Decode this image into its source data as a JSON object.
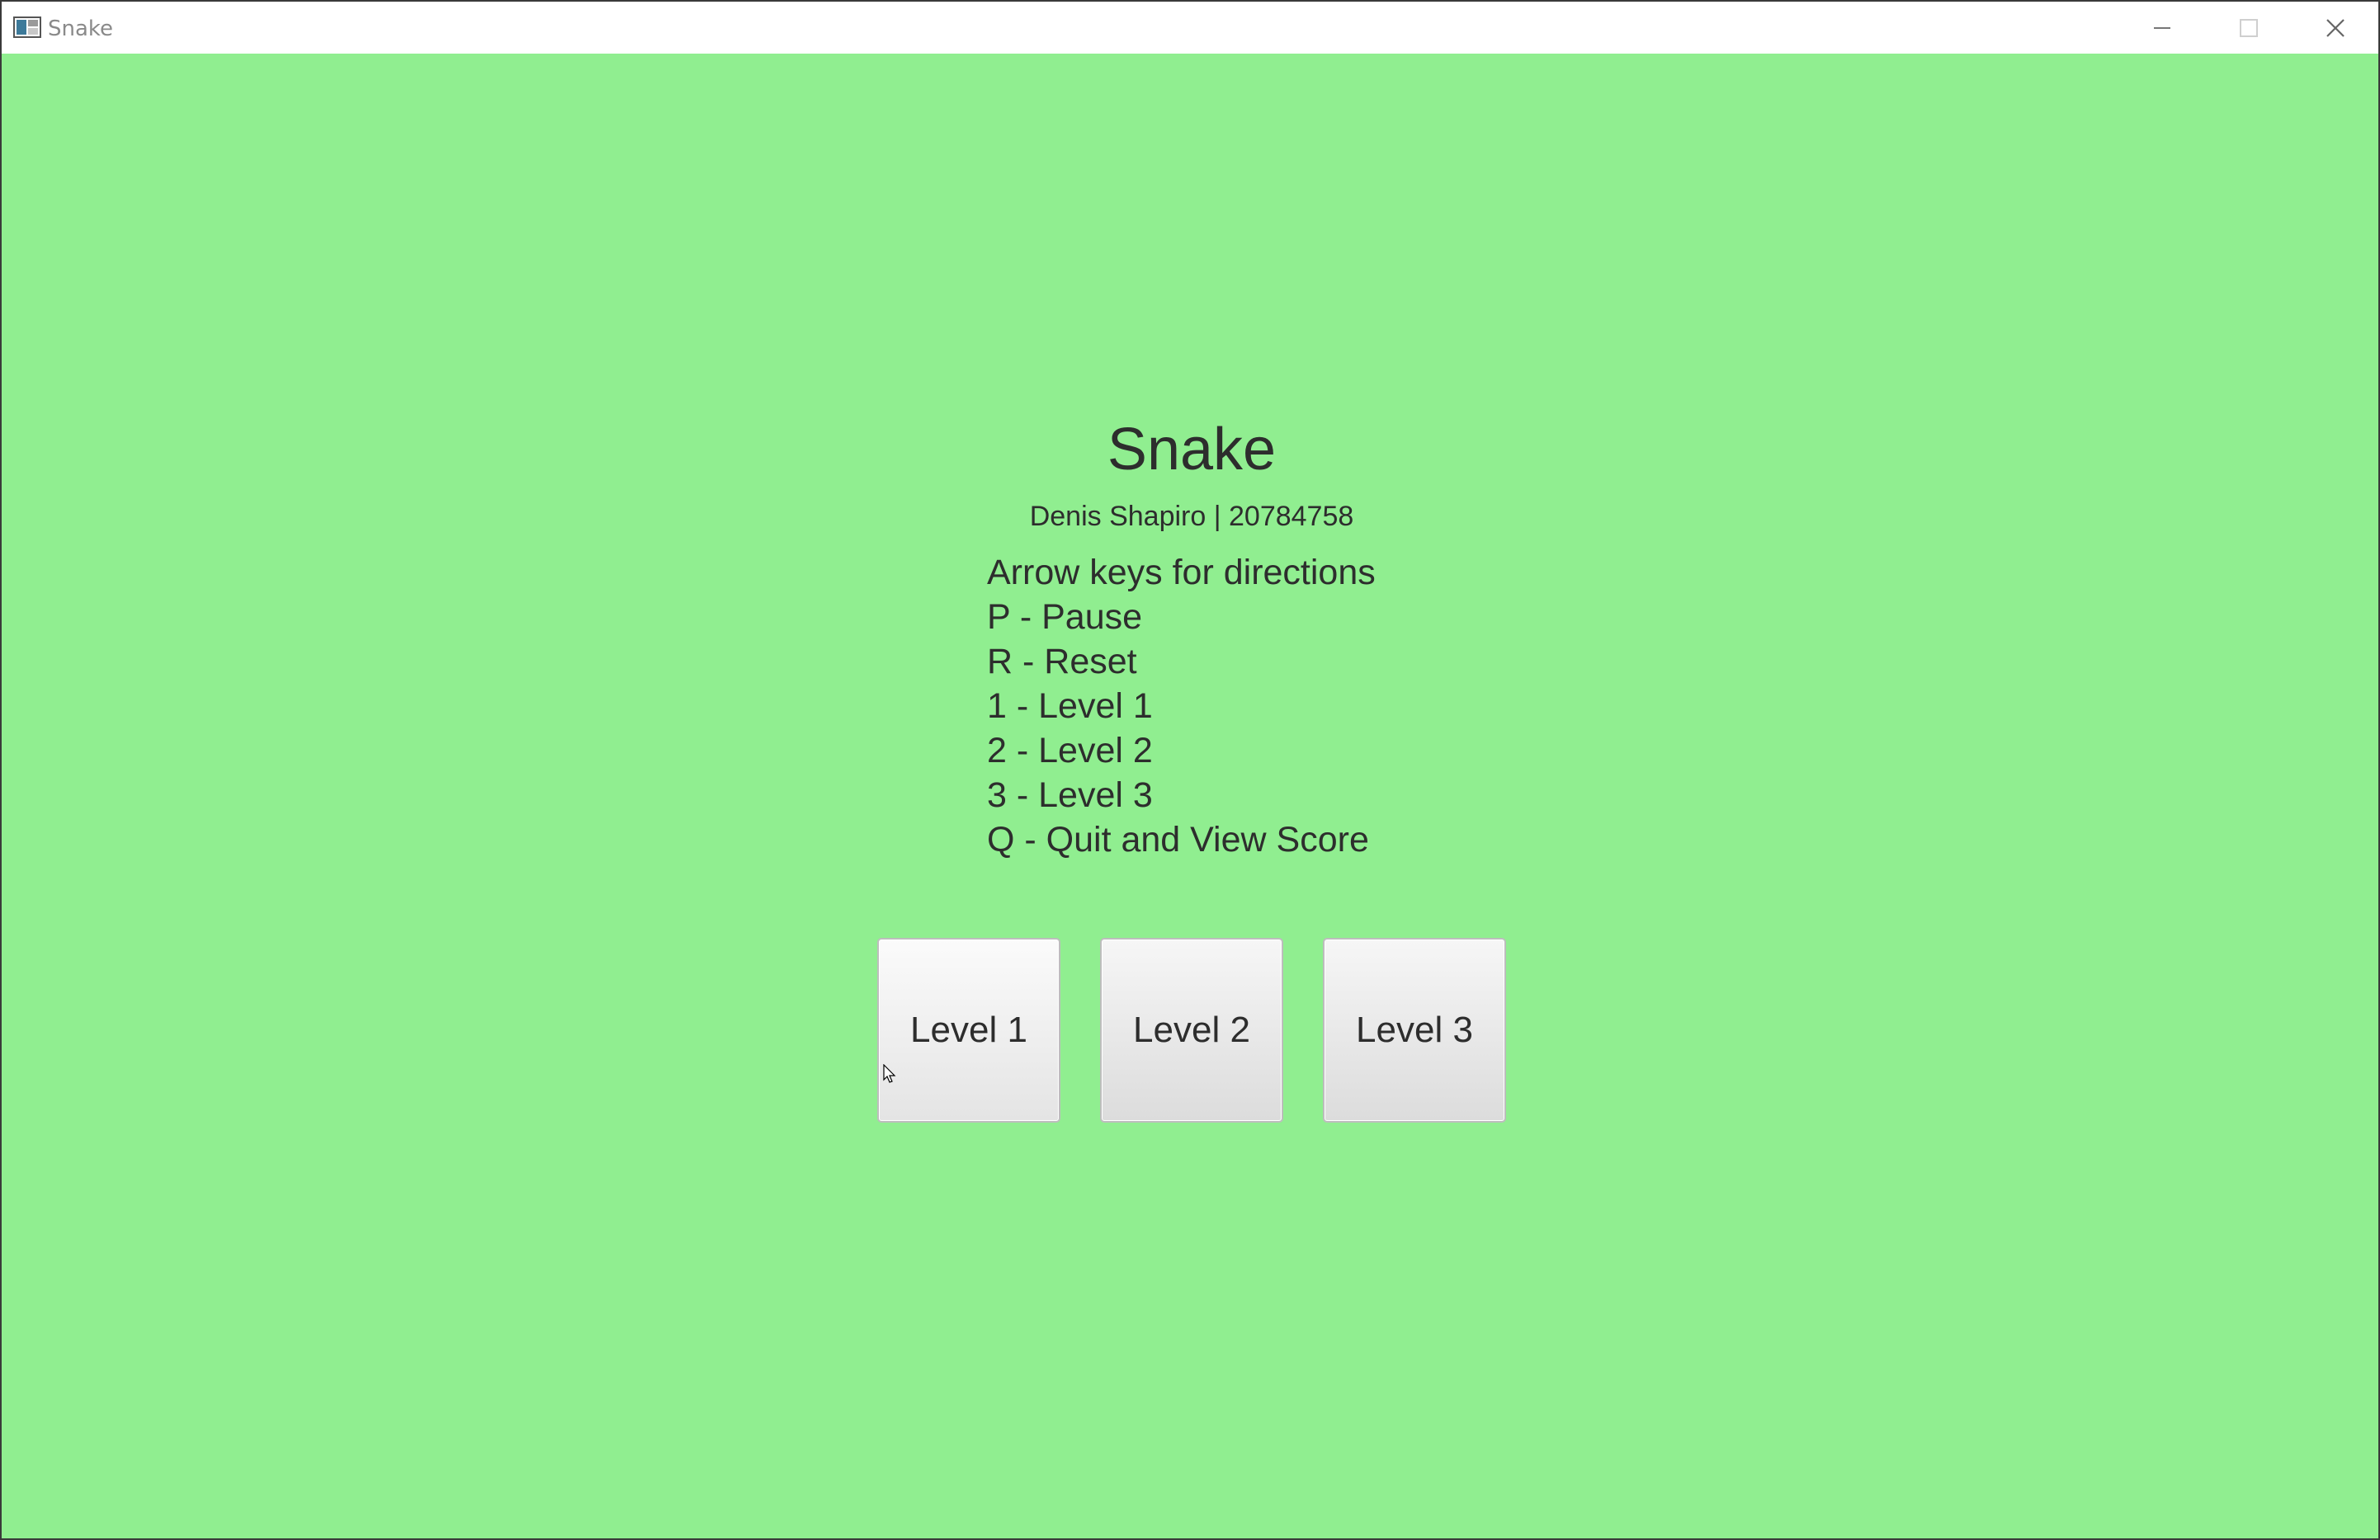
{
  "window": {
    "title": "Snake",
    "icon": "app-window-icon",
    "controls": [
      "minimize-icon",
      "maximize-icon",
      "close-icon"
    ]
  },
  "game": {
    "title": "Snake",
    "author": "Denis Shapiro | 20784758",
    "instructions": [
      "Arrow keys for directions",
      "P - Pause",
      "R - Reset",
      "1 - Level 1",
      "2 - Level 2",
      "3 - Level 3",
      "Q - Quit and View Score"
    ]
  },
  "levels": [
    {
      "label": "Level 1"
    },
    {
      "label": "Level 2"
    },
    {
      "label": "Level 3"
    }
  ],
  "colors": {
    "background": "#90ee90",
    "text": "#2d2d2d",
    "titlebar": "#ffffff"
  }
}
